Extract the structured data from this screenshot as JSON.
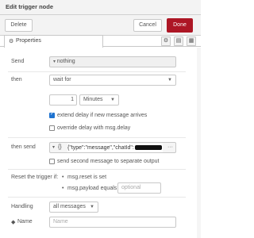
{
  "title": "Edit trigger node",
  "toolbar": {
    "delete_label": "Delete",
    "cancel_label": "Cancel",
    "done_label": "Done"
  },
  "tabs": {
    "properties_label": "Properties"
  },
  "form": {
    "send_label": "Send",
    "send_value": "nothing",
    "then_label": "then",
    "then_value": "wait for",
    "duration_value": "1",
    "duration_units": "Minutes",
    "extend_label": "extend delay if new message arrives",
    "extend_checked": true,
    "override_label": "override delay with msg.delay",
    "override_checked": false,
    "then_send_label": "then send",
    "then_send_type": "{}",
    "then_send_value": "{\"type\":\"message\",\"chatId\":",
    "second_msg_label": "send second message to separate output",
    "reset_label": "Reset the trigger if:",
    "reset_item1": "msg.reset is set",
    "reset_item2": "msg.payload equals",
    "reset_placeholder": "optional",
    "handling_label": "Handling",
    "handling_value": "all messages",
    "name_label": "Name",
    "name_placeholder": "Name"
  }
}
